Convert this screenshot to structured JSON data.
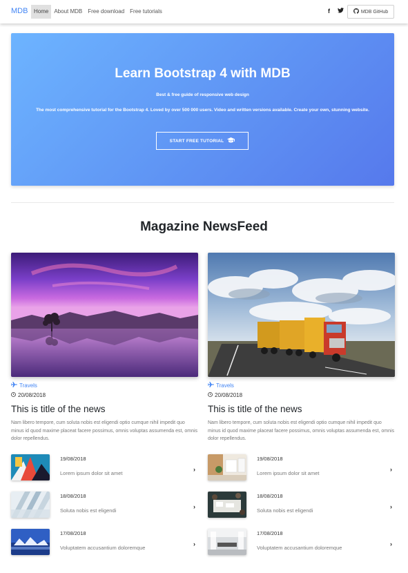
{
  "navbar": {
    "brand": "MDB",
    "links": [
      "Home",
      "About MDB",
      "Free download",
      "Free tutorials"
    ],
    "social": {
      "facebook": "f",
      "twitter": "●"
    },
    "github_label": "MDB GitHub"
  },
  "hero": {
    "title": "Learn Bootstrap 4 with MDB",
    "subtitle": "Best & free guide of responsive web design",
    "description": "The most comprehensive tutorial for the Bootstrap 4. Loved by over 500 000 users. Video and written versions available. Create your own, stunning website.",
    "button_label": "START FREE TUTORIAL",
    "gradient": [
      "#6db4ff",
      "#5679ec"
    ]
  },
  "section": {
    "title": "Magazine NewsFeed"
  },
  "columns": [
    {
      "main": {
        "category": "Travels",
        "date": "20/08/2018",
        "title": "This is title of the news",
        "excerpt": "Nam libero tempore, cum soluta nobis est eligendi optio cumque nihil impedit quo minus id quod maxime placeat facere possimus, omnis voluptas assumenda est, omnis dolor repellendus."
      },
      "items": [
        {
          "date": "19/08/2018",
          "text": "Lorem ipsum dolor sit amet"
        },
        {
          "date": "18/08/2018",
          "text": "Soluta nobis est eligendi"
        },
        {
          "date": "17/08/2018",
          "text": "Voluptatem accusantium doloremque"
        }
      ]
    },
    {
      "main": {
        "category": "Travels",
        "date": "20/08/2018",
        "title": "This is title of the news",
        "excerpt": "Nam libero tempore, cum soluta nobis est eligendi optio cumque nihil impedit quo minus id quod maxime placeat facere possimus, omnis voluptas assumenda est, omnis dolor repellendus."
      },
      "items": [
        {
          "date": "19/08/2018",
          "text": "Lorem ipsum dolor sit amet"
        },
        {
          "date": "18/08/2018",
          "text": "Soluta nobis est eligendi"
        },
        {
          "date": "17/08/2018",
          "text": "Voluptatem accusantium doloremque"
        }
      ]
    }
  ],
  "colors": {
    "accent": "#4285f4",
    "text": "#212529",
    "muted": "#777777"
  }
}
